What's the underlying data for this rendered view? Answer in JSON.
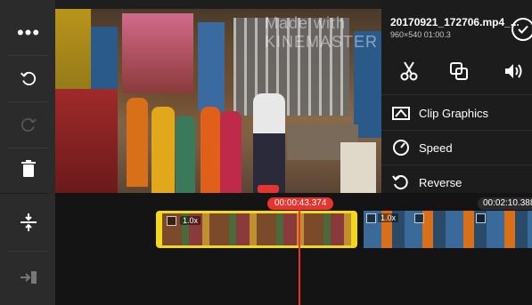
{
  "clip": {
    "file_name": "20170921_172706.mp4_...",
    "meta": "960×540  01:00.3"
  },
  "preview": {
    "watermark": "Made with KINEMASTER"
  },
  "menu": {
    "items": [
      {
        "label": "Clip Graphics",
        "icon": "clip-graphics-icon"
      },
      {
        "label": "Speed",
        "icon": "speed-icon"
      },
      {
        "label": "Reverse",
        "icon": "reverse-icon"
      }
    ]
  },
  "tools": [
    "scissors-icon",
    "crop-pan-icon",
    "volume-icon"
  ],
  "left_toolbar": [
    "more-icon",
    "undo-icon",
    "redo-icon",
    "delete-icon"
  ],
  "timeline": {
    "current_time": "00:00:43.374",
    "end_time": "00:02:10.388",
    "speed_tag": "1.0x",
    "next_speed_tag": "1.0x"
  },
  "colors": {
    "accent_red": "#e8342f",
    "selected_yellow": "#f2d71b",
    "panel_bg": "#1c1c1c",
    "toolbar_bg": "#2b2b2b"
  }
}
